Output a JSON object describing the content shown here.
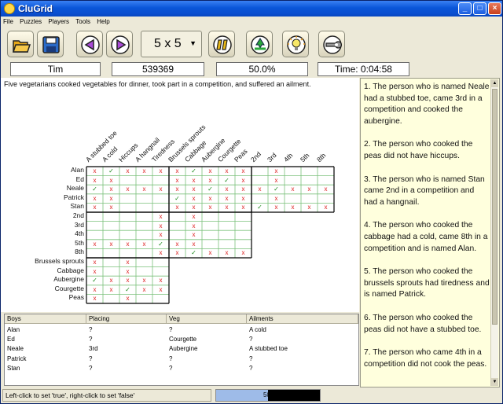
{
  "window": {
    "title": "CluGrid",
    "min": "_",
    "max": "□",
    "close": "×"
  },
  "menu": [
    "File",
    "Puzzles",
    "Players",
    "Tools",
    "Help"
  ],
  "toolbar": {
    "grid_size": "5 x 5"
  },
  "status": {
    "player": "Tim",
    "puzzle_id": "539369",
    "progress": "50.0%",
    "time": "Time: 0:04:58"
  },
  "puzzle": {
    "intro": "Five vegetarians cooked vegetables for dinner, took part in a competition, and suffered an ailment."
  },
  "grid": {
    "columns_ailments": [
      "A stubbed toe",
      "A cold",
      "Hiccups",
      "A hangnail",
      "Tiredness"
    ],
    "columns_veg": [
      "Brussels sprouts",
      "Cabbage",
      "Aubergine",
      "Courgette",
      "Peas"
    ],
    "columns_placing": [
      "2nd",
      "3rd",
      "4th",
      "5th",
      "8th"
    ],
    "rows_boys": [
      "Alan",
      "Ed",
      "Neale",
      "Patrick",
      "Stan"
    ],
    "rows_placing": [
      "2nd",
      "3rd",
      "4th",
      "5th",
      "8th"
    ],
    "rows_veg": [
      "Brussels sprouts",
      "Cabbage",
      "Aubergine",
      "Courgette",
      "Peas"
    ],
    "boys_marks": [
      [
        "x",
        "✓",
        "x",
        "x",
        "x",
        "x",
        "✓",
        "x",
        "x",
        "x",
        "",
        "x",
        "",
        "",
        ""
      ],
      [
        "x",
        "x",
        "",
        "",
        "",
        "x",
        "x",
        "x",
        "✓",
        "x",
        "",
        "x",
        "",
        "",
        ""
      ],
      [
        "✓",
        "x",
        "x",
        "x",
        "x",
        "x",
        "x",
        "✓",
        "x",
        "x",
        "x",
        "✓",
        "x",
        "x",
        "x"
      ],
      [
        "x",
        "x",
        "",
        "",
        "",
        "✓",
        "x",
        "x",
        "x",
        "x",
        "",
        "x",
        "",
        "",
        ""
      ],
      [
        "x",
        "x",
        "",
        "",
        "",
        "x",
        "x",
        "x",
        "x",
        "x",
        "✓",
        "x",
        "x",
        "x",
        "x"
      ]
    ],
    "placing_marks": [
      [
        "",
        "",
        "",
        "",
        "x",
        "",
        "x",
        "",
        "",
        ""
      ],
      [
        "",
        "",
        "",
        "",
        "x",
        "",
        "x",
        "",
        "",
        ""
      ],
      [
        "",
        "",
        "",
        "",
        "x",
        "",
        "x",
        "",
        "",
        ""
      ],
      [
        "x",
        "x",
        "x",
        "x",
        "✓",
        "x",
        "x",
        "",
        "",
        ""
      ],
      [
        "",
        "",
        "",
        "",
        "x",
        "x",
        "✓",
        "x",
        "x",
        "x"
      ]
    ],
    "veg_marks": [
      [
        "x",
        "",
        "x",
        "",
        ""
      ],
      [
        "x",
        "",
        "x",
        "",
        ""
      ],
      [
        "✓",
        "x",
        "x",
        "x",
        "x"
      ],
      [
        "x",
        "x",
        "✓",
        "x",
        "x"
      ],
      [
        "x",
        "",
        "x",
        "",
        ""
      ]
    ]
  },
  "summary": {
    "headers": [
      "Boys",
      "Placing",
      "Veg",
      "Ailments"
    ],
    "rows": [
      [
        "Alan",
        "?",
        "?",
        "A cold"
      ],
      [
        "Ed",
        "?",
        "Courgette",
        "?"
      ],
      [
        "Neale",
        "3rd",
        "Aubergine",
        "A stubbed toe"
      ],
      [
        "Patrick",
        "?",
        "?",
        "?"
      ],
      [
        "Stan",
        "?",
        "?",
        "?"
      ]
    ]
  },
  "clues": [
    "1. The person who is named Neale had a stubbed toe, came 3rd in a competition and cooked the aubergine.",
    "2. The person who cooked the peas did not have hiccups.",
    "3. The person who is named Stan came 2nd in a competition and had a hangnail.",
    "4. The person who cooked the cabbage had a cold, came 8th in a competition and is named Alan.",
    "5. The person who cooked the brussels sprouts had tiredness and is named Patrick.",
    "6. The person who cooked the peas did not have a stubbed toe.",
    "7. The person who came 4th in a competition did not cook the peas."
  ],
  "statusbar": {
    "hint": "Left-click to set 'true', right-click to set 'false'",
    "progress_label": "50%",
    "progress_value": 0.5
  },
  "colors": {
    "title": "#0a56d8",
    "cross": "#d22222",
    "tick": "#1a8a1a",
    "clue_bg": "#ffffdd"
  }
}
